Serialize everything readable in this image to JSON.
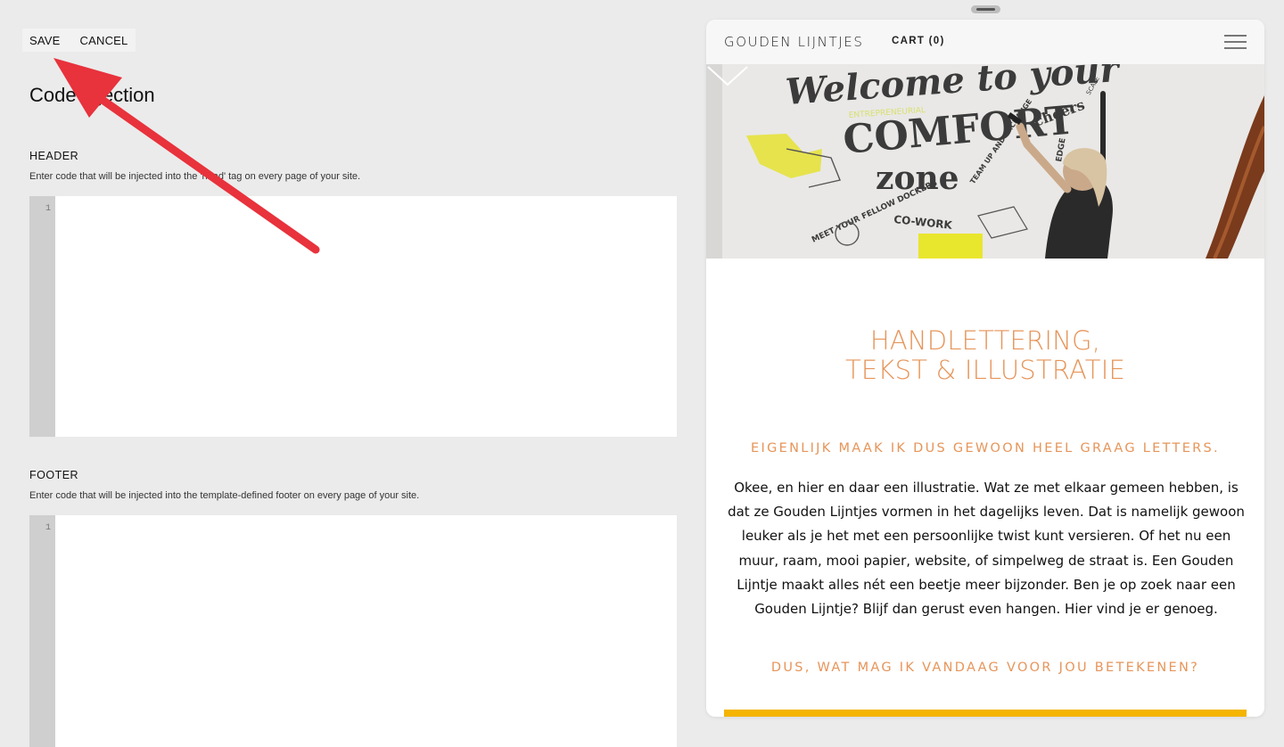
{
  "toolbar": {
    "save_label": "SAVE",
    "cancel_label": "CANCEL"
  },
  "panel": {
    "title": "Code Injection"
  },
  "header_section": {
    "label": "HEADER",
    "description": "Enter code that will be injected into the 'head' tag on every page of your site.",
    "line_number": "1",
    "code": ""
  },
  "footer_section": {
    "label": "FOOTER",
    "description": "Enter code that will be injected into the template-defined footer on every page of your site.",
    "line_number": "1",
    "code": ""
  },
  "annotation": {
    "arrow_color": "#e8323c"
  },
  "preview": {
    "brand": "GOUDEN LIJNTJES",
    "cart": "CART (0)",
    "menu_icon": "hamburger-menu-icon",
    "banner": {
      "mural_words": [
        "Welcome to your",
        "ENTREPRENEURIAL",
        "COMFORT",
        "zone",
        "MEET YOUR FELLOW DOCKERS",
        "CO-WORK",
        "TEAM UP AND EXCHANGE",
        "cheers",
        "EDGE",
        "SCALE"
      ],
      "scroll_icon": "chevron-down-icon"
    },
    "headline_line1": "HANDLETTERING,",
    "headline_line2": "TEKST & ILLUSTRATIE",
    "subheading1": "EIGENLIJK MAAK IK DUS GEWOON HEEL GRAAG LETTERS.",
    "paragraph": "Okee, en hier en daar een illustratie. Wat ze met elkaar gemeen hebben, is dat ze Gouden Lijntjes vormen in het dagelijks leven. Dat is namelijk gewoon leuker als je het met een persoonlijke twist kunt versieren. Of het nu een muur, raam, mooi papier, website, of simpelweg de straat is. Een Gouden Lijntje maakt alles nét een beetje meer bijzonder. Ben je op zoek naar een Gouden Lijntje? Blijf dan gerust even hangen. Hier vind je er genoeg.",
    "subheading2": "DUS, WAT MAG IK VANDAAG VOOR JOU BETEKENEN?",
    "accent_color": "#e6955a",
    "bar_color": "#f4b400"
  }
}
